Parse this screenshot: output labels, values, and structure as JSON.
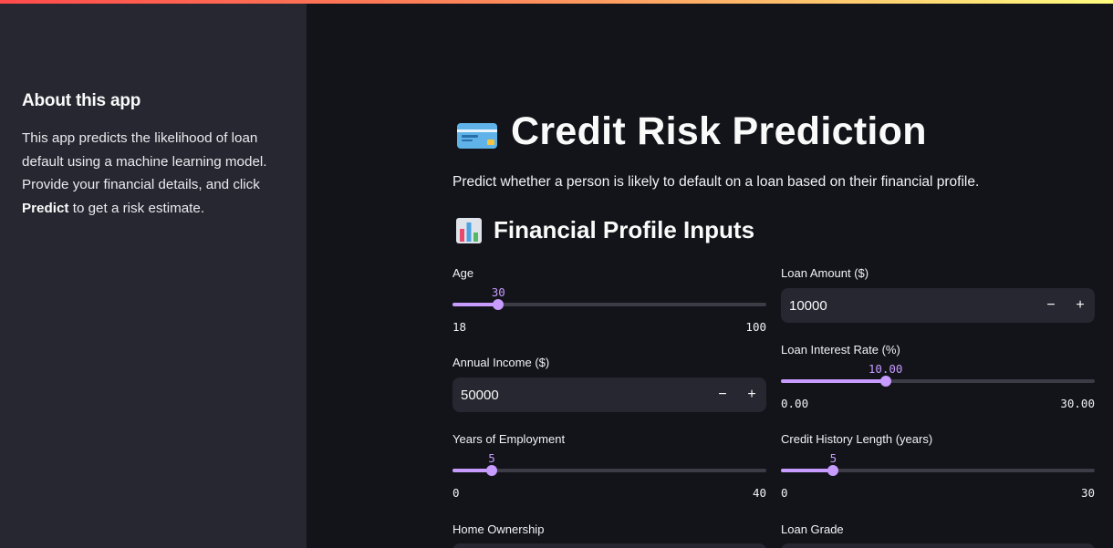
{
  "sidebar": {
    "heading": "About this app",
    "text_1": "This app predicts the likelihood of loan default using a machine learning model. Provide your financial details, and click ",
    "text_bold": "Predict",
    "text_2": " to get a risk estimate."
  },
  "main": {
    "title": "Credit Risk Prediction",
    "title_icon": "credit-card-emoji",
    "description": "Predict whether a person is likely to default on a loan based on their financial profile.",
    "subheading": "Financial Profile Inputs",
    "subheading_icon": "bar-chart-emoji"
  },
  "inputs": {
    "age": {
      "label": "Age",
      "value": "30",
      "min": "18",
      "max": "100",
      "fraction": 0.1463
    },
    "annual_income": {
      "label": "Annual Income ($)",
      "value": "50000",
      "minus": "−",
      "plus": "+"
    },
    "years_employment": {
      "label": "Years of Employment",
      "value": "5",
      "min": "0",
      "max": "40",
      "fraction": 0.125
    },
    "home_ownership": {
      "label": "Home Ownership"
    },
    "loan_amount": {
      "label": "Loan Amount ($)",
      "value": "10000",
      "minus": "−",
      "plus": "+"
    },
    "interest_rate": {
      "label": "Loan Interest Rate (%)",
      "value": "10.00",
      "min": "0.00",
      "max": "30.00",
      "fraction": 0.3333
    },
    "credit_history": {
      "label": "Credit History Length (years)",
      "value": "5",
      "min": "0",
      "max": "30",
      "fraction": 0.1667
    },
    "loan_grade": {
      "label": "Loan Grade"
    }
  },
  "colors": {
    "accent": "#c79bff",
    "sidebar_bg": "#262730",
    "main_bg": "#131419"
  }
}
